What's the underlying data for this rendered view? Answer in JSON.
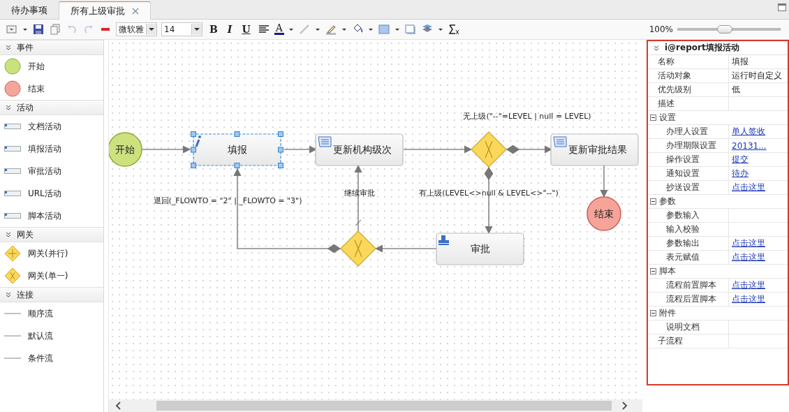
{
  "tabs": [
    {
      "label": "待办事项",
      "selected": false,
      "closable": false
    },
    {
      "label": "所有上级审批",
      "selected": true,
      "closable": true
    }
  ],
  "toolbar": {
    "font": "微软雅",
    "font_size": "14",
    "text_buttons": [
      {
        "label": "B",
        "kind": "bold"
      },
      {
        "label": "I",
        "kind": "italic"
      },
      {
        "label": "U",
        "kind": "underline"
      },
      {
        "label": "A",
        "kind": "color"
      }
    ],
    "zoom": "100%",
    "zoom_slider": {
      "level": 0.46
    }
  },
  "palette": [
    {
      "title": "事件",
      "expanded": true,
      "items": [
        {
          "label": "开始",
          "kind": "start"
        },
        {
          "label": "结束",
          "kind": "end"
        }
      ]
    },
    {
      "title": "活动",
      "expanded": true,
      "items": [
        {
          "label": "文档活动",
          "kind": "activity"
        },
        {
          "label": "填报活动",
          "kind": "activity"
        },
        {
          "label": "审批活动",
          "kind": "activity"
        },
        {
          "label": "URL活动",
          "kind": "activity"
        },
        {
          "label": "脚本活动",
          "kind": "activity"
        }
      ]
    },
    {
      "title": "网关",
      "expanded": true,
      "items": [
        {
          "label": "网关(并行)",
          "kind": "parallel"
        },
        {
          "label": "网关(单一)",
          "kind": "exclusive"
        }
      ]
    },
    {
      "title": "连接",
      "expanded": true,
      "items": [
        {
          "label": "顺序流",
          "kind": "flow"
        },
        {
          "label": "默认流",
          "kind": "flow"
        },
        {
          "label": "条件流",
          "kind": "flow"
        }
      ]
    }
  ],
  "diagram": {
    "nodes": [
      {
        "kind": "start",
        "label": "开始",
        "selected": false
      },
      {
        "kind": "fill",
        "label": "填报",
        "selected": true
      },
      {
        "kind": "script",
        "label": "更新机构级次",
        "selected": false
      },
      {
        "kind": "gateway",
        "selected": false
      },
      {
        "kind": "script",
        "label": "更新审批结果",
        "selected": false
      },
      {
        "kind": "end",
        "label": "结束",
        "selected": false
      },
      {
        "kind": "approve",
        "label": "审批",
        "selected": false
      },
      {
        "kind": "gateway",
        "selected": false
      }
    ],
    "edges": [
      {
        "kind": "sequence"
      },
      {
        "kind": "sequence"
      },
      {
        "kind": "sequence"
      },
      {
        "kind": "conditional",
        "label": "无上级(\"--\"=LEVEL | null = LEVEL)"
      },
      {
        "kind": "sequence"
      },
      {
        "kind": "conditional",
        "label": "有上级(LEVEL<>null & LEVEL<>\"--\")"
      },
      {
        "kind": "sequence"
      },
      {
        "kind": "conditional",
        "label": "退回(_FLOWTO = \"2\" | _FLOWTO = \"3\")"
      },
      {
        "kind": "default",
        "label": "继续审批"
      }
    ]
  },
  "properties": {
    "title": "i@report填报活动",
    "rows": [
      {
        "kind": "text",
        "label": "名称",
        "value": "填报"
      },
      {
        "kind": "text",
        "label": "活动对象",
        "value": "运行时自定义"
      },
      {
        "kind": "text",
        "label": "优先级别",
        "value": "低"
      },
      {
        "kind": "text",
        "label": "描述"
      },
      {
        "kind": "group",
        "label": "设置",
        "expanded": true,
        "children": [
          {
            "kind": "link",
            "label": "办理人设置",
            "value": "单人签收"
          },
          {
            "kind": "link",
            "label": "办理期限设置",
            "value": "20131..."
          },
          {
            "kind": "link",
            "label": "操作设置",
            "value": "提交"
          },
          {
            "kind": "link",
            "label": "通知设置",
            "value": "待办"
          },
          {
            "kind": "link",
            "label": "抄送设置",
            "value": "点击这里"
          }
        ]
      },
      {
        "kind": "group",
        "label": "参数",
        "expanded": true,
        "children": [
          {
            "kind": "text",
            "label": "参数输入"
          },
          {
            "kind": "text",
            "label": "输入校验"
          },
          {
            "kind": "link",
            "label": "参数输出",
            "value": "点击这里"
          },
          {
            "kind": "link",
            "label": "表元赋值",
            "value": "点击这里"
          }
        ]
      },
      {
        "kind": "group",
        "label": "脚本",
        "expanded": true,
        "children": [
          {
            "kind": "link",
            "label": "流程前置脚本",
            "value": "点击这里"
          },
          {
            "kind": "link",
            "label": "流程后置脚本",
            "value": "点击这里"
          }
        ]
      },
      {
        "kind": "group",
        "label": "附件",
        "expanded": true,
        "children": [
          {
            "kind": "text",
            "label": "说明文档"
          }
        ]
      },
      {
        "kind": "text",
        "label": "子流程"
      }
    ]
  }
}
